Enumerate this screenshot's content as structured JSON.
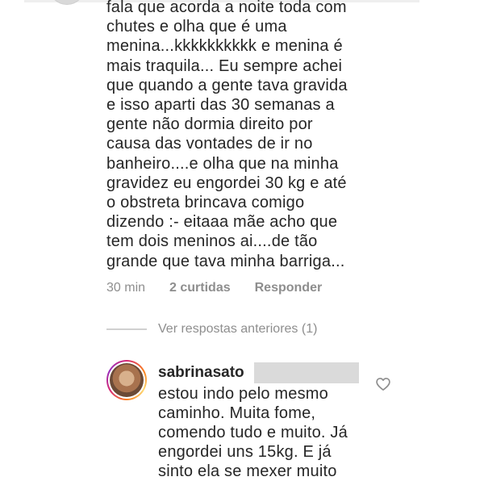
{
  "previous_comment": {
    "text": "fala que acorda a noite toda com\nchutes e olha que é uma\nmenina...kkkkkkkkkk e menina é\nmais traquila... Eu sempre achei\nque quando a gente tava gravida\ne isso aparti das 30 semanas a\ngente não dormia direito por\ncausa das vontades de ir no\nbanheiro....e olha que na minha\ngravidez eu engordei 30 kg e até\no obstreta brincava comigo\ndizendo :- eitaaa mãe acho que\ntem dois meninos ai....de tão\ngrande que tava minha barriga...",
    "time": "30 min",
    "likes": "2 curtidas",
    "reply_label": "Responder"
  },
  "replies_toggle": {
    "label": "Ver respostas anteriores (1)"
  },
  "reply": {
    "username": "sabrinasato",
    "text": "estou indo pelo mesmo\ncaminho. Muita fome,\ncomendo tudo e muito. Já\nengordei uns 15kg. E já\nsinto ela se mexer muito"
  },
  "icons": {
    "like": "heart-outline-icon"
  },
  "colors": {
    "text": "#262626",
    "meta": "#8e8e8e",
    "story_ring_start": "#d62976",
    "story_ring_end": "#fa7e1e"
  }
}
